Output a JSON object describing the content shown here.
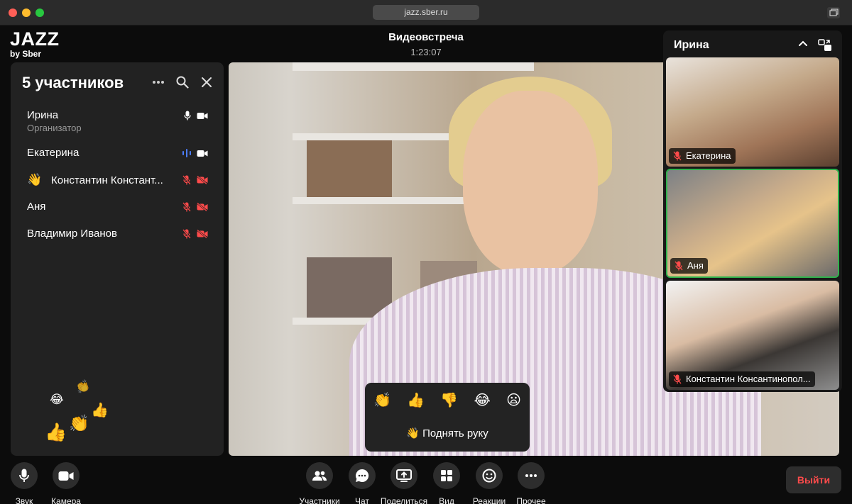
{
  "browser": {
    "url": "jazz.sber.ru"
  },
  "brand": {
    "name": "JAZZ",
    "sub": "by Sber"
  },
  "meeting": {
    "title": "Видеовстреча",
    "time": "1:23:07"
  },
  "participants_panel": {
    "title": "5 участников",
    "participants": [
      {
        "name": "Ирина",
        "role": "Организатор",
        "mic": "on",
        "camera": "on"
      },
      {
        "name": "Екатерина",
        "mic": "speaking",
        "camera": "on"
      },
      {
        "name": "Константин Констант...",
        "hand_raised": true,
        "mic": "muted",
        "camera": "off"
      },
      {
        "name": "Аня",
        "mic": "muted",
        "camera": "off"
      },
      {
        "name": "Владимир Иванов",
        "mic": "muted",
        "camera": "off"
      }
    ],
    "floating_reactions": [
      "😂",
      "👏",
      "👍",
      "👏",
      "👍"
    ]
  },
  "reactions_popup": {
    "emojis": [
      "👏",
      "👍",
      "👎",
      "😂",
      "😦"
    ],
    "raise_hand": "Поднять руку",
    "raise_hand_icon": "👋"
  },
  "video_column": {
    "title": "Ирина",
    "tiles": [
      {
        "name": "Екатерина",
        "active": false
      },
      {
        "name": "Аня",
        "active": true
      },
      {
        "name": "Константин Консантинопол..."
      }
    ]
  },
  "toolbar": {
    "left": [
      {
        "label": "Звук",
        "icon": "mic-icon"
      },
      {
        "label": "Камера",
        "icon": "camera-icon"
      }
    ],
    "center": [
      {
        "label": "Участники",
        "icon": "people-icon"
      },
      {
        "label": "Чат",
        "icon": "chat-icon"
      },
      {
        "label": "Поделиться",
        "icon": "share-screen-icon"
      },
      {
        "label": "Вид",
        "icon": "grid-icon"
      },
      {
        "label": "Реакции",
        "icon": "smile-icon"
      },
      {
        "label": "Прочее",
        "icon": "more-icon"
      }
    ],
    "exit": "Выйти"
  },
  "colors": {
    "accent_green": "#2fb24c",
    "danger": "#ff4b4b",
    "speaking": "#4c7dff",
    "panel": "#222222"
  }
}
